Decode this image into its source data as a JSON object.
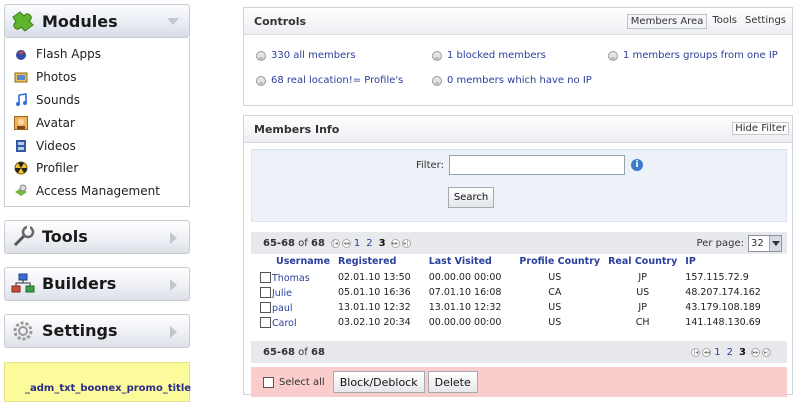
{
  "sidebar": {
    "modules": {
      "title": "Modules",
      "items": [
        {
          "label": "Flash Apps",
          "icon": "flash-icon"
        },
        {
          "label": "Photos",
          "icon": "photos-icon"
        },
        {
          "label": "Sounds",
          "icon": "music-note-icon"
        },
        {
          "label": "Avatar",
          "icon": "avatar-icon"
        },
        {
          "label": "Videos",
          "icon": "film-icon"
        },
        {
          "label": "Profiler",
          "icon": "radiation-icon"
        },
        {
          "label": "Access Management",
          "icon": "access-icon"
        }
      ]
    },
    "tools": {
      "title": "Tools"
    },
    "builders": {
      "title": "Builders"
    },
    "settings": {
      "title": "Settings"
    },
    "promo": {
      "text": "_adm_txt_boonex_promo_title"
    }
  },
  "controls": {
    "title": "Controls",
    "tabs": [
      {
        "label": "Members Area",
        "active": true
      },
      {
        "label": "Tools",
        "active": false
      },
      {
        "label": "Settings",
        "active": false
      }
    ],
    "stats": [
      {
        "label": "330 all members"
      },
      {
        "label": "1 blocked members"
      },
      {
        "label": "1 members groups from one IP"
      },
      {
        "label": "68 real location!= Profile's"
      },
      {
        "label": "0 members which have no IP"
      }
    ]
  },
  "members_info": {
    "title": "Members Info",
    "hide_filter": "Hide Filter",
    "filter_label": "Filter:",
    "filter_value": "",
    "search_button": "Search",
    "range_text": "65-68",
    "of_text": "of",
    "total": "68",
    "pages": [
      "1",
      "2",
      "3"
    ],
    "current_page": "3",
    "per_page_label": "Per page:",
    "per_page_value": "32",
    "columns": [
      "Username",
      "Registered",
      "Last Visited",
      "Profile Country",
      "Real Country",
      "IP"
    ],
    "rows": [
      {
        "username": "Thomas",
        "registered": "02.01.10 13:50",
        "last_visited": "00.00.00 00:00",
        "profile_country": "US",
        "real_country": "JP",
        "ip": "157.115.72.9"
      },
      {
        "username": "Julie",
        "registered": "05.01.10 16:36",
        "last_visited": "07.01.10 16:08",
        "profile_country": "CA",
        "real_country": "US",
        "ip": "48.207.174.162"
      },
      {
        "username": "paul",
        "registered": "13.01.10 12:32",
        "last_visited": "13.01.10 12:32",
        "profile_country": "US",
        "real_country": "JP",
        "ip": "43.179.108.189"
      },
      {
        "username": "Carol",
        "registered": "03.02.10 20:34",
        "last_visited": "00.00.00 00:00",
        "profile_country": "US",
        "real_country": "CH",
        "ip": "141.148.130.69"
      }
    ],
    "select_all": "Select all",
    "block_button": "Block/Deblock",
    "delete_button": "Delete"
  }
}
